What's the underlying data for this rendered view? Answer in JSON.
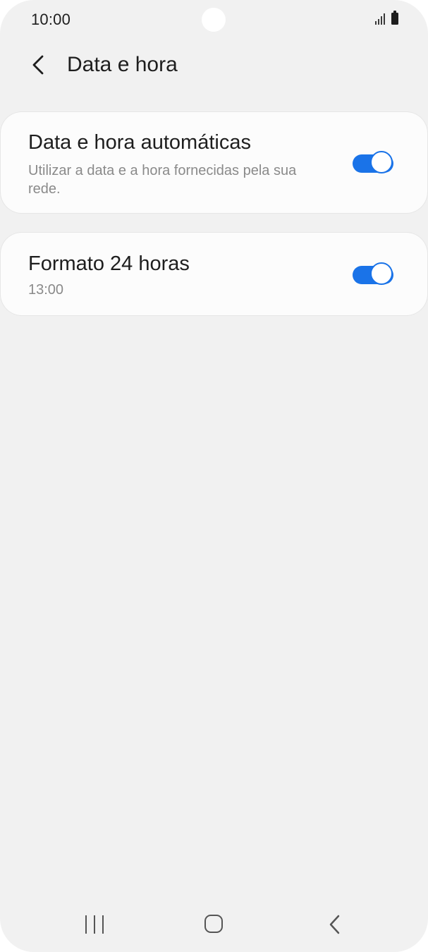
{
  "status_bar": {
    "time": "10:00"
  },
  "header": {
    "title": "Data e hora"
  },
  "settings": [
    {
      "title": "Data e hora automáticas",
      "subtitle": "Utilizar a data e a hora fornecidas pela sua rede.",
      "enabled": true
    },
    {
      "title": "Formato 24 horas",
      "subtitle": "13:00",
      "enabled": true
    }
  ],
  "colors": {
    "accent": "#1a73e8",
    "background": "#f1f1f1",
    "card": "#fcfcfc"
  },
  "icons": {
    "back": "chevron-left-icon",
    "signal": "signal-icon",
    "battery": "battery-icon",
    "nav_recent": "recent-apps-icon",
    "nav_home": "home-icon",
    "nav_back": "back-icon"
  }
}
